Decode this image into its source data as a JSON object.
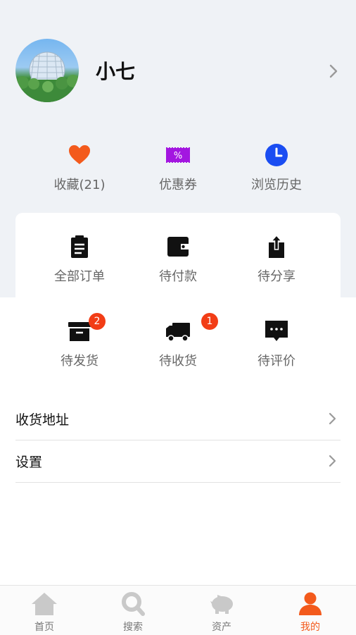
{
  "colors": {
    "accent": "#f35a1c",
    "badge": "#f23d16",
    "header_bg": "#eff2f6"
  },
  "profile": {
    "name": "小七"
  },
  "quick_links": [
    {
      "label": "收藏(21)",
      "icon": "heart-icon"
    },
    {
      "label": "优惠券",
      "icon": "coupon-icon"
    },
    {
      "label": "浏览历史",
      "icon": "clock-icon"
    }
  ],
  "orders": [
    {
      "label": "全部订单",
      "icon": "clipboard-icon"
    },
    {
      "label": "待付款",
      "icon": "wallet-icon"
    },
    {
      "label": "待分享",
      "icon": "share-icon"
    },
    {
      "label": "待发货",
      "icon": "box-icon",
      "badge": "2"
    },
    {
      "label": "待收货",
      "icon": "truck-icon",
      "badge": "1"
    },
    {
      "label": "待评价",
      "icon": "comment-icon"
    }
  ],
  "menu": [
    {
      "label": "收货地址"
    },
    {
      "label": "设置"
    }
  ],
  "tabbar": [
    {
      "label": "首页",
      "icon": "home-icon"
    },
    {
      "label": "搜索",
      "icon": "search-icon"
    },
    {
      "label": "资产",
      "icon": "piggy-bank-icon"
    },
    {
      "label": "我的",
      "icon": "user-icon",
      "active": true
    }
  ]
}
